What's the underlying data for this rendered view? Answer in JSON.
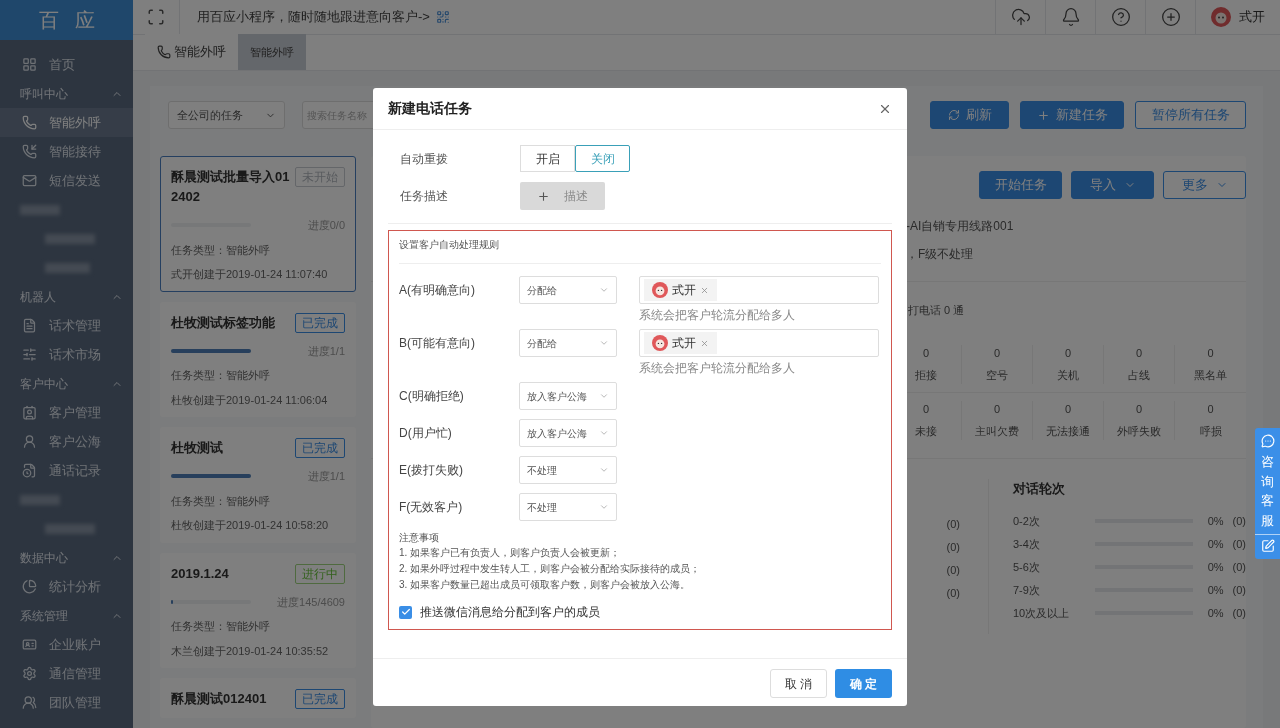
{
  "logo": "百应",
  "topbar": {
    "promo": "用百应小程序，随时随地跟进意向客户->",
    "user": "式开"
  },
  "sidebar": {
    "groups": [
      {
        "kind": "plain",
        "items": [
          {
            "label": "首页",
            "selected": false
          }
        ]
      },
      {
        "kind": "section",
        "title": "呼叫中心",
        "items": [
          {
            "label": "智能外呼",
            "selected": true
          },
          {
            "label": "智能接待",
            "selected": false
          },
          {
            "label": "短信发送",
            "selected": false
          }
        ]
      },
      {
        "kind": "blurred"
      },
      {
        "kind": "section",
        "title": "机器人",
        "items": [
          {
            "label": "话术管理",
            "selected": false
          },
          {
            "label": "话术市场",
            "selected": false
          }
        ]
      },
      {
        "kind": "section",
        "title": "客户中心",
        "items": [
          {
            "label": "客户管理",
            "selected": false
          },
          {
            "label": "客户公海",
            "selected": false
          },
          {
            "label": "通话记录",
            "selected": false
          }
        ]
      },
      {
        "kind": "blurred_short"
      },
      {
        "kind": "section",
        "title": "数据中心",
        "items": [
          {
            "label": "统计分析",
            "selected": false
          }
        ]
      },
      {
        "kind": "section",
        "title": "系统管理",
        "items": [
          {
            "label": "企业账户",
            "selected": false
          },
          {
            "label": "通信管理",
            "selected": false
          },
          {
            "label": "团队管理",
            "selected": false
          }
        ]
      }
    ]
  },
  "tabs": [
    {
      "label": "智能外呼",
      "selected": false
    },
    {
      "label": "智能外呼",
      "selected": true
    }
  ],
  "toolbar": {
    "scope": "全公司的任务",
    "search_placeholder": "搜索任务名称",
    "buttons": [
      "刷新",
      "新建任务",
      "暂停所有任务"
    ]
  },
  "tasks": [
    {
      "title": "酥晨测试批量导入012402",
      "status": "未开始",
      "kind": "not_started",
      "level": 0,
      "progress": "进度0/0",
      "type": "任务类型：智能外呼",
      "created": "式开创建于2019-01-24 11:07:40",
      "selected": true
    },
    {
      "title": "杜牧测试标签功能",
      "status": "已完成",
      "kind": "done",
      "level": 1,
      "progress": "进度1/1",
      "type": "任务类型：智能外呼",
      "created": "杜牧创建于2019-01-24 11:06:04",
      "selected": false
    },
    {
      "title": "杜牧测试",
      "status": "已完成",
      "kind": "done",
      "level": 1,
      "progress": "进度1/1",
      "type": "任务类型：智能外呼",
      "created": "杜牧创建于2019-01-24 10:58:20",
      "selected": false
    },
    {
      "title": "2019.1.24",
      "status": "进行中",
      "kind": "running",
      "level": 0.03,
      "progress": "进度145/4609",
      "type": "任务类型：智能外呼",
      "created": "木兰创建于2019-01-24 10:35:52",
      "selected": false
    },
    {
      "title": "酥晨测试012401",
      "status": "已完成",
      "kind": "done",
      "selected": false
    }
  ],
  "detail": {
    "buttons": [
      {
        "label": "开始任务",
        "kind": "primary"
      },
      {
        "label": "导入",
        "kind": "dropdown"
      },
      {
        "label": "更多",
        "kind": "outline"
      }
    ],
    "info": [
      "-AI自销专用线路001",
      "，F级不处理"
    ],
    "calls": "打电话 0 通",
    "stats": [
      [
        {
          "value": "0",
          "label": "拒接"
        },
        {
          "value": "0",
          "label": "空号"
        },
        {
          "value": "0",
          "label": "关机"
        },
        {
          "value": "0",
          "label": "占线"
        },
        {
          "value": "0",
          "label": "黑名单"
        }
      ],
      [
        {
          "value": "0",
          "label": "未接"
        },
        {
          "value": "0",
          "label": "主叫欠费"
        },
        {
          "value": "0",
          "label": "无法接通"
        },
        {
          "value": "0",
          "label": "外呼失败"
        },
        {
          "value": "0",
          "label": "呼损"
        }
      ]
    ],
    "intent_counts": [
      "(0)",
      "(0)",
      "(0)",
      "(0)"
    ],
    "rounds": {
      "title": "对话轮次",
      "rows": [
        {
          "label": "0-2次",
          "level": 0,
          "percent": "0%",
          "count": "(0)"
        },
        {
          "label": "3-4次",
          "level": 0,
          "percent": "0%",
          "count": "(0)"
        },
        {
          "label": "5-6次",
          "level": 0,
          "percent": "0%",
          "count": "(0)"
        },
        {
          "label": "7-9次",
          "level": 0,
          "percent": "0%",
          "count": "(0)"
        },
        {
          "label": "10次及以上",
          "level": 0,
          "percent": "0%",
          "count": "(0)"
        }
      ]
    }
  },
  "consult": "咨询客服",
  "modal": {
    "title": "新建电话任务",
    "auto_redial": {
      "label": "自动重拨",
      "options": [
        {
          "label": "开启",
          "selected": false
        },
        {
          "label": "关闭",
          "selected": true
        }
      ]
    },
    "description": {
      "label": "任务描述",
      "button": "描述"
    },
    "rules": {
      "title": "设置客户自动处理规则",
      "items": [
        {
          "label": "A(有明确意向)",
          "value": "分配给",
          "assignees": [
            "式开"
          ],
          "hint": "系统会把客户轮流分配给多人"
        },
        {
          "label": "B(可能有意向)",
          "value": "分配给",
          "assignees": [
            "式开"
          ],
          "hint": "系统会把客户轮流分配给多人"
        },
        {
          "label": "C(明确拒绝)",
          "value": "放入客户公海"
        },
        {
          "label": "D(用户忙)",
          "value": "放入客户公海"
        },
        {
          "label": "E(拨打失败)",
          "value": "不处理"
        },
        {
          "label": "F(无效客户)",
          "value": "不处理"
        }
      ],
      "notes_title": "注意事项",
      "notes": [
        "1. 如果客户已有负责人，则客户负责人会被更新；",
        "2. 如果外呼过程中发生转人工，则客户会被分配给实际接待的成员；",
        "3. 如果客户数量已超出成员可领取客户数，则客户会被放入公海。"
      ],
      "push": {
        "label": "推送微信消息给分配到客户的成员",
        "checked": true
      }
    },
    "cancel": "取 消",
    "ok": "确 定"
  }
}
